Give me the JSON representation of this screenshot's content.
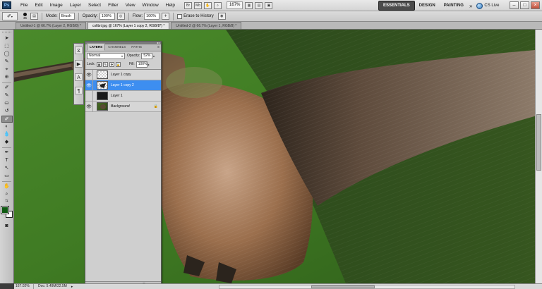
{
  "app": {
    "logo": "Ps"
  },
  "menu": [
    "File",
    "Edit",
    "Image",
    "Layer",
    "Select",
    "Filter",
    "View",
    "Window",
    "Help"
  ],
  "menubar_zoom": "167%",
  "workspaces": {
    "items": [
      "ESSENTIALS",
      "DESIGN",
      "PAINTING"
    ],
    "active": "ESSENTIALS",
    "more": "»"
  },
  "cslive": "CS Live",
  "window_controls": [
    "–",
    "□",
    "×"
  ],
  "options": {
    "brush_size": "35",
    "mode_label": "Mode:",
    "mode_value": "Brush",
    "opacity_label": "Opacity:",
    "opacity_value": "100%",
    "flow_label": "Flow:",
    "flow_value": "100%",
    "erase_history_label": "Erase to History"
  },
  "tabs": [
    {
      "label": "Untitled-1 @ 66.7% (Layer 2, RGB/8) *",
      "active": false
    },
    {
      "label": "colibri.jpg @ 167% (Layer 1 copy 2, RGB/8*) *",
      "active": true
    },
    {
      "label": "Untitled-2 @ 66.7% (Layer 1, RGB/8) *",
      "active": false
    }
  ],
  "tools": [
    "➤",
    "⬚",
    "◯",
    "✎",
    "⌖",
    "⊕",
    "✐",
    "✎",
    "⛀",
    "◐",
    "✋",
    "◆",
    "T",
    "↖",
    "▭",
    "✋",
    "🔍"
  ],
  "colors": {
    "foreground": "#0f5a12",
    "background": "#ffffff",
    "canvas_green": "#3f7a23",
    "selected_layer": "#3d8ef0"
  },
  "layers_panel": {
    "tabs": [
      "LAYERS",
      "CHANNELS",
      "PATHS"
    ],
    "active_tab": "LAYERS",
    "menu_glyph": "≡",
    "blend_mode": "Normal",
    "opacity_label": "Opacity:",
    "opacity_value": "52%",
    "lock_label": "Lock:",
    "fill_label": "Fill:",
    "fill_value": "100%",
    "layers": [
      {
        "name": "Layer 1 copy",
        "selected": false,
        "thumb": "t-copy",
        "italic": false
      },
      {
        "name": "Layer 1 copy 2",
        "selected": true,
        "thumb": "t-copy2",
        "italic": false
      },
      {
        "name": "Layer 1",
        "selected": false,
        "thumb": "t-l1",
        "italic": false
      },
      {
        "name": "Background",
        "selected": false,
        "thumb": "t-bg",
        "italic": true,
        "locked": true
      }
    ],
    "footer_icons": [
      "∞",
      "fx",
      "◐",
      "◑",
      "▭",
      "▤",
      "🗑"
    ]
  },
  "status": {
    "zoom": "167.02%",
    "doc": "Doc: 5.49M/22.5M",
    "arrow": "▸"
  }
}
